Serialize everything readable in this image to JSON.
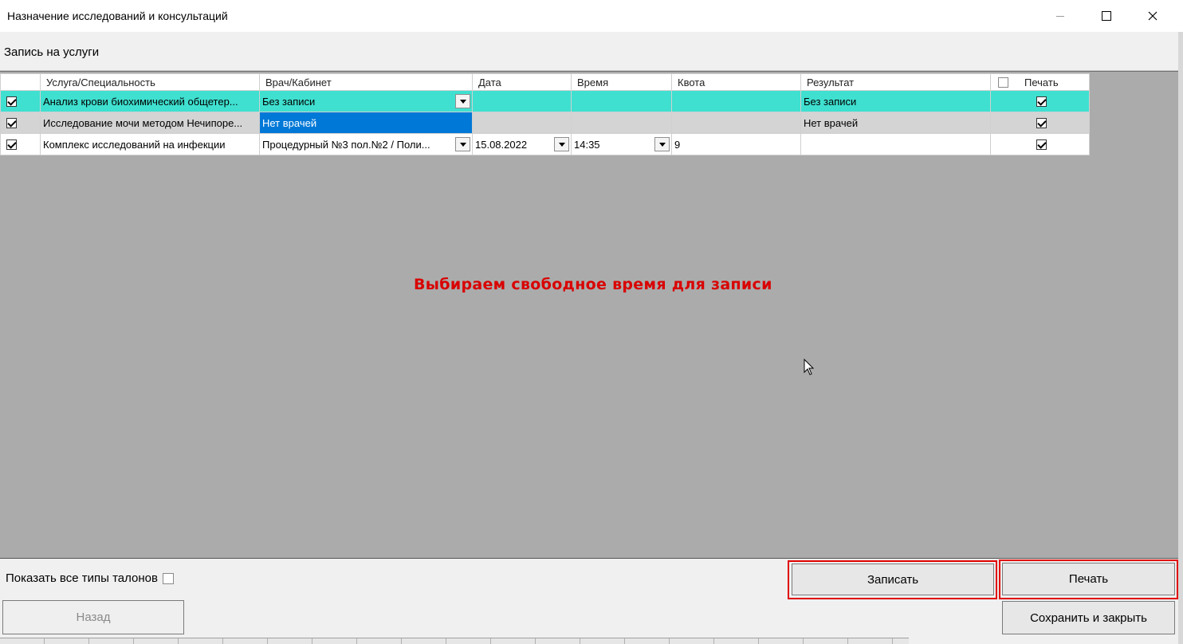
{
  "window": {
    "title": "Назначение исследований и консультаций",
    "section_title": "Запись на услуги"
  },
  "grid": {
    "columns": [
      "Услуга/Специальность",
      "Врач/Кабинет",
      "Дата",
      "Время",
      "Квота",
      "Результат",
      "Печать"
    ],
    "header_print_checked": false,
    "rows": [
      {
        "checked": true,
        "service": "Анализ крови биохимический общетер...",
        "doctor": "Без записи",
        "date": "",
        "time": "",
        "quota": "",
        "result": "Без записи",
        "print": true,
        "style": "cyan"
      },
      {
        "checked": true,
        "service": "Исследование мочи методом Нечипоре...",
        "doctor": "Нет врачей",
        "date": "",
        "time": "",
        "quota": "",
        "result": "Нет врачей",
        "print": true,
        "style": "gray"
      },
      {
        "checked": true,
        "service": "Комплекс исследований на инфекции",
        "doctor": "Процедурный №3 пол.№2 / Поли...",
        "date": "15.08.2022",
        "time": "14:35",
        "quota": "9",
        "result": "",
        "print": true,
        "style": "white"
      }
    ]
  },
  "hint_text": "Выбираем свободное время для записи",
  "footer": {
    "show_all_label": "Показать все типы талонов",
    "show_all_checked": false,
    "record_button": "Записать",
    "print_button": "Печать",
    "back_button": "Назад",
    "save_close_button": "Сохранить и закрыть"
  },
  "colors": {
    "row_highlight": "#3fe0d0",
    "selection": "#0078d7",
    "hint": "#d90000",
    "callout": "#e00000"
  }
}
